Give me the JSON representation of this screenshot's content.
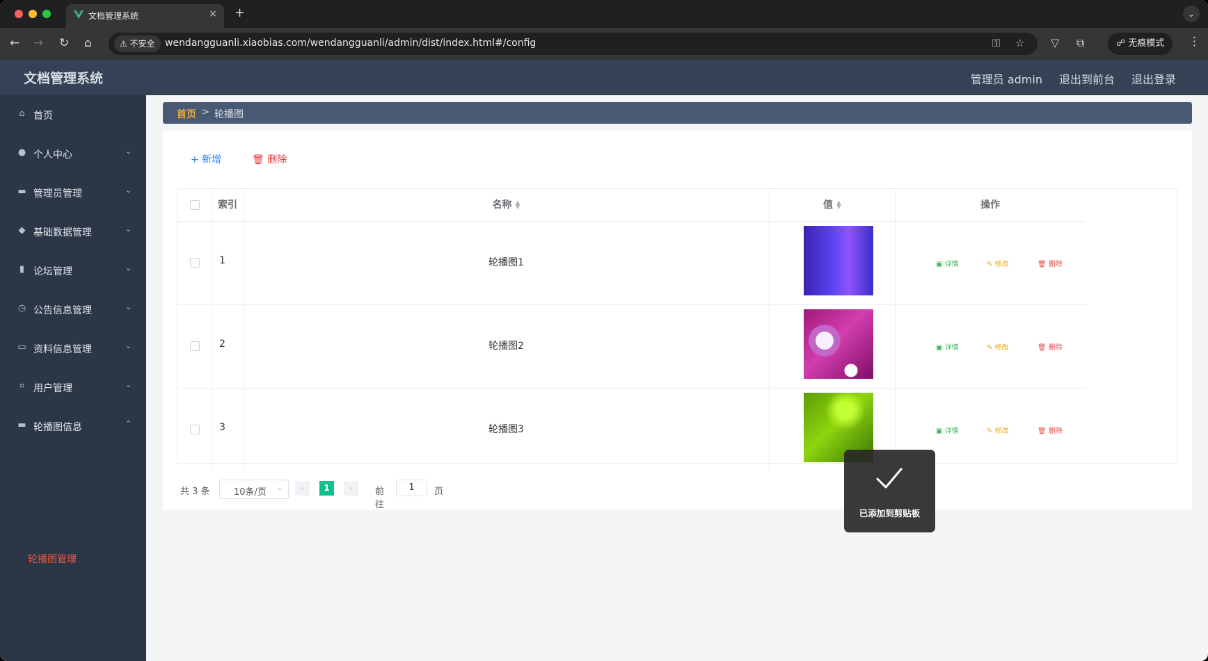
{
  "browser": {
    "tab_title": "文档管理系统",
    "tab_close": "×",
    "new_tab": "+",
    "tab_menu": "⌄",
    "security_label": "⚠ 不安全",
    "url": "wendangguanli.xiaobias.com/wendangguanli/admin/dist/index.html#/config",
    "mode_label": "☍ 无痕模式",
    "icons": {
      "back": "←",
      "forward": "→",
      "reload": "↻",
      "home": "⌂",
      "password": "⚿",
      "star": "☆",
      "vue": "▽",
      "extensions": "⧉",
      "more": "⋮"
    }
  },
  "header": {
    "title": "文档管理系统",
    "user": "管理员 admin",
    "exit_front": "退出到前台",
    "logout": "退出登录"
  },
  "sidebar": {
    "items": [
      {
        "label": "首页",
        "icon": "⌂"
      },
      {
        "label": "个人中心",
        "icon": "●",
        "arrow": "⌄"
      },
      {
        "label": "管理员管理",
        "icon": "▬",
        "arrow": "⌄"
      },
      {
        "label": "基础数据管理",
        "icon": "◆",
        "arrow": "⌄"
      },
      {
        "label": "论坛管理",
        "icon": "▮",
        "arrow": "⌄"
      },
      {
        "label": "公告信息管理",
        "icon": "◷",
        "arrow": "⌄"
      },
      {
        "label": "资料信息管理",
        "icon": "▭",
        "arrow": "⌄"
      },
      {
        "label": "用户管理",
        "icon": "⌗",
        "arrow": "⌄"
      },
      {
        "label": "轮播图信息",
        "icon": "▬",
        "arrow": "⌃"
      }
    ],
    "submenu": "轮播图管理"
  },
  "breadcrumb": {
    "home": "首页",
    "separator": ">",
    "current": "轮播图"
  },
  "actions": {
    "add": "+ 新增",
    "delete": "🗑 删除"
  },
  "table": {
    "headers": [
      "索引",
      "名称",
      "值",
      "操作"
    ],
    "rows": [
      {
        "index": "1",
        "name": "轮播图1"
      },
      {
        "index": "2",
        "name": "轮播图2"
      },
      {
        "index": "3",
        "name": "轮播图3"
      }
    ],
    "row_actions": {
      "detail": "▣ 详情",
      "edit": "✎ 修改",
      "delete": "🗑 删除"
    }
  },
  "pagination": {
    "total": "共 3 条",
    "page_size": "10条/页",
    "current_page": "1",
    "goto_label": "前往",
    "goto_value": "1",
    "goto_unit": "页",
    "prev": "‹",
    "next": "›",
    "size_arrow": "⌄"
  },
  "toast": {
    "message": "已添加到剪贴板"
  },
  "colors": {
    "header": "#354154",
    "sidebar": "#2b3647",
    "active_menu": "#f0523f",
    "page_active": "#0fc18e"
  }
}
